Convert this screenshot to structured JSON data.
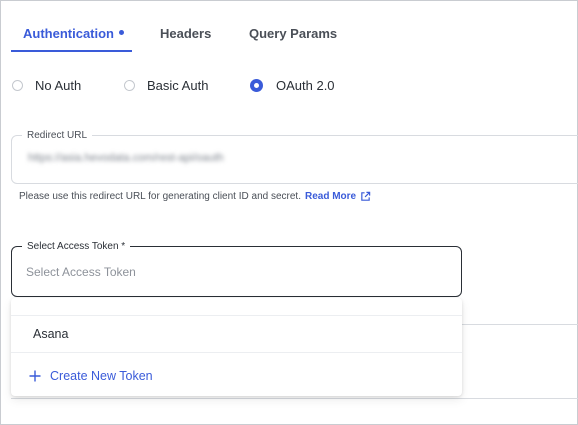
{
  "tabs": [
    {
      "label": "Authentication",
      "active": true
    },
    {
      "label": "Headers",
      "active": false
    },
    {
      "label": "Query Params",
      "active": false
    }
  ],
  "auth_options": [
    {
      "label": "No Auth",
      "selected": false
    },
    {
      "label": "Basic Auth",
      "selected": false
    },
    {
      "label": "OAuth 2.0",
      "selected": true
    }
  ],
  "redirect": {
    "label": "Redirect URL",
    "value": "https://asia.hevodata.com/rest-api/oauth",
    "helper_text": "Please use this redirect URL for generating client ID and secret.",
    "read_more_label": "Read More"
  },
  "access_token": {
    "label": "Select Access Token *",
    "placeholder": "Select Access Token"
  },
  "dropdown": {
    "items": [
      "Asana"
    ],
    "create_label": "Create New Token"
  },
  "colors": {
    "accent": "#3a5bd9",
    "text": "#2a2f36",
    "border": "#d8dbe0"
  },
  "icons": {
    "external_link": "external-link-icon",
    "plus": "plus-icon",
    "active_tab_indicator": "dot-icon"
  }
}
